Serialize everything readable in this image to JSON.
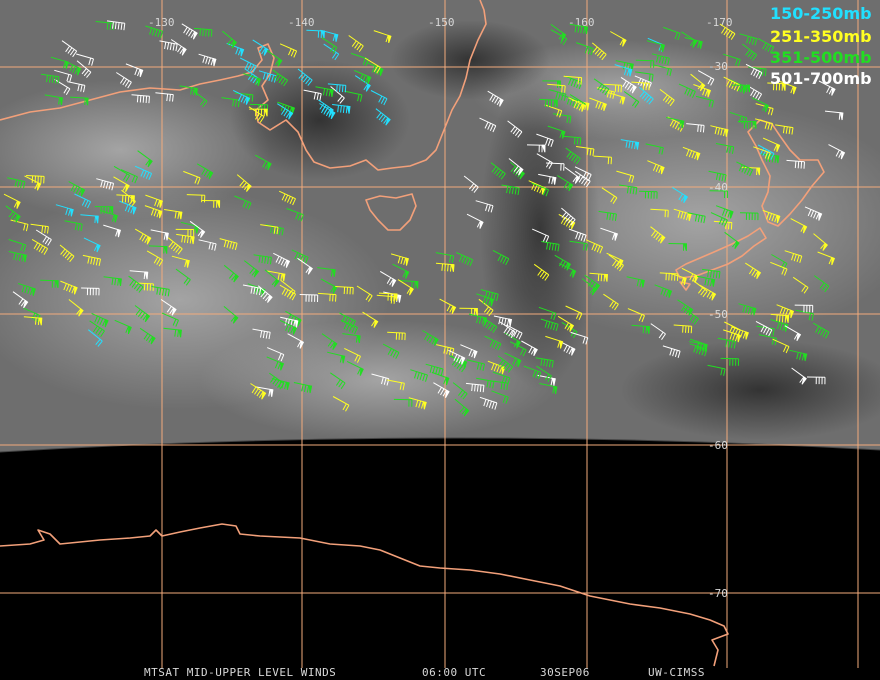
{
  "map": {
    "longitude_labels": [
      "-130",
      "-140",
      "-150",
      "-160",
      "-170"
    ],
    "latitude_labels": [
      "-30",
      "-40",
      "-50",
      "-60",
      "-70"
    ],
    "grid_color": "#f2ab7c",
    "coastline_color": "#f2a07a"
  },
  "legend": [
    {
      "label": "150-250mb",
      "color": "#22e0ff"
    },
    {
      "label": "251-350mb",
      "color": "#ffff22"
    },
    {
      "label": "351-500mb",
      "color": "#22dd22"
    },
    {
      "label": "501-700mb",
      "color": "#ffffff"
    }
  ],
  "footer": {
    "title": "MTSAT MID-UPPER LEVEL WINDS",
    "time": "06:00 UTC",
    "date": "30SEP06",
    "source": "UW-CIMSS"
  }
}
